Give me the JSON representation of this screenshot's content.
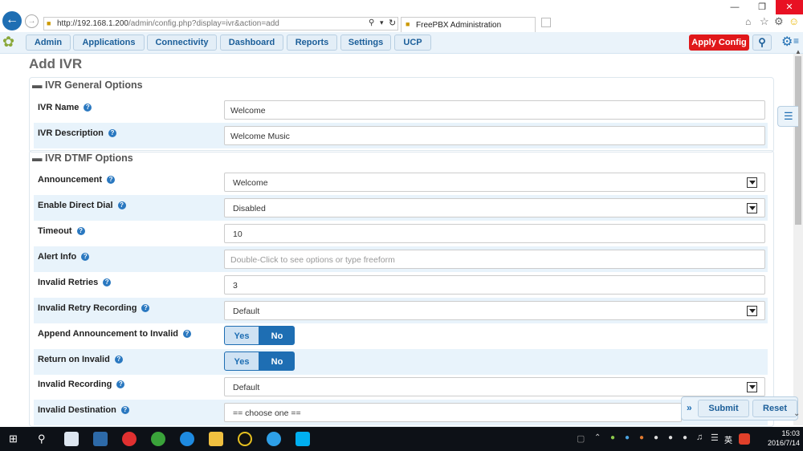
{
  "browser": {
    "url_host": "http://192.168.1.200",
    "url_path": "/admin/config.php?display=ivr&action=add",
    "tab_title": "FreePBX Administration",
    "window_controls": [
      "minimize-icon",
      "restore-icon",
      "close-icon"
    ]
  },
  "nav": {
    "items": [
      "Admin",
      "Applications",
      "Connectivity",
      "Dashboard",
      "Reports",
      "Settings",
      "UCP"
    ],
    "apply_label": "Apply Config"
  },
  "page": {
    "title": "Add IVR"
  },
  "general": {
    "heading": "IVR General Options",
    "name_label": "IVR Name",
    "name_value": "Welcome",
    "desc_label": "IVR Description",
    "desc_value": "Welcome Music"
  },
  "dtmf": {
    "heading": "IVR DTMF Options",
    "announcement_label": "Announcement",
    "announcement_value": "Welcome",
    "direct_dial_label": "Enable Direct Dial",
    "direct_dial_value": "Disabled",
    "timeout_label": "Timeout",
    "timeout_value": "10",
    "alert_label": "Alert Info",
    "alert_placeholder": "Double-Click to see options or type freeform",
    "retries_label": "Invalid Retries",
    "retries_value": "3",
    "retry_rec_label": "Invalid Retry Recording",
    "retry_rec_value": "Default",
    "append_label": "Append Announcement to Invalid",
    "append_yes": "Yes",
    "append_no": "No",
    "append_selected": "No",
    "return_label": "Return on Invalid",
    "return_yes": "Yes",
    "return_no": "No",
    "return_selected": "No",
    "inv_rec_label": "Invalid Recording",
    "inv_rec_value": "Default",
    "inv_dest_label": "Invalid Destination",
    "inv_dest_value": "== choose one =="
  },
  "actions": {
    "submit": "Submit",
    "reset": "Reset"
  },
  "taskbar": {
    "time": "15:03",
    "date": "2016/7/14",
    "ime": "英"
  },
  "colors": {
    "apply": "#e0181a",
    "accent": "#1e6eb3",
    "row_alt": "#e8f3fb"
  }
}
